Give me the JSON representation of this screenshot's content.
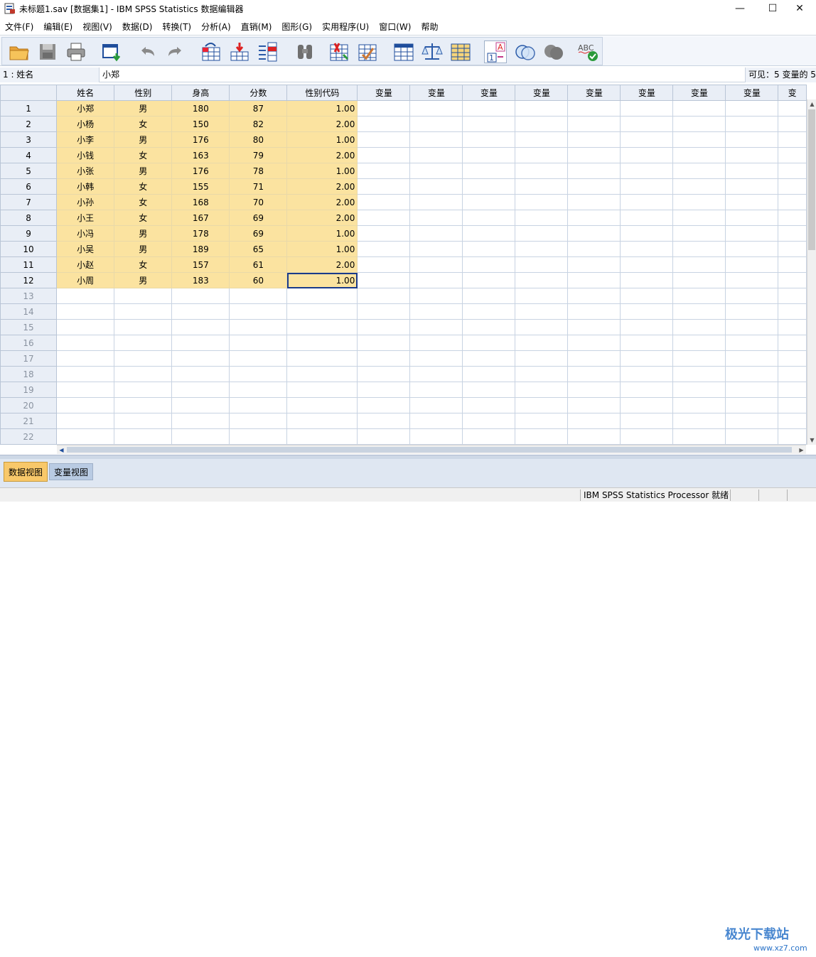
{
  "window": {
    "title": "未标题1.sav [数据集1] - IBM SPSS Statistics 数据编辑器",
    "minimize": "—",
    "maximize": "☐",
    "close": "✕"
  },
  "menu": [
    "文件(F)",
    "编辑(E)",
    "视图(V)",
    "数据(D)",
    "转换(T)",
    "分析(A)",
    "直销(M)",
    "图形(G)",
    "实用程序(U)",
    "窗口(W)",
    "帮助"
  ],
  "toolbar": {
    "icons": [
      "open-folder-icon",
      "save-icon",
      "print-icon",
      "dialog-recall-icon",
      "undo-icon",
      "redo-icon",
      "goto-case-icon",
      "goto-variable-icon",
      "variables-icon",
      "find-icon",
      "insert-cases-icon",
      "insert-variable-icon",
      "split-file-icon",
      "weight-cases-icon",
      "select-cases-icon",
      "value-labels-icon",
      "use-sets-icon",
      "show-all-variables-icon",
      "spell-check-icon"
    ]
  },
  "cell_editor": {
    "ref": "1 : 姓名",
    "value": "小郑",
    "visible": "可见：5 变量的 5"
  },
  "grid": {
    "columns": [
      "姓名",
      "性别",
      "身高",
      "分数",
      "性别代码",
      "变量",
      "变量",
      "变量",
      "变量",
      "变量",
      "变量",
      "变量",
      "变量",
      "变"
    ],
    "rows": [
      [
        "小郑",
        "男",
        "180",
        "87",
        "1.00"
      ],
      [
        "小杨",
        "女",
        "150",
        "82",
        "2.00"
      ],
      [
        "小李",
        "男",
        "176",
        "80",
        "1.00"
      ],
      [
        "小钱",
        "女",
        "163",
        "79",
        "2.00"
      ],
      [
        "小张",
        "男",
        "176",
        "78",
        "1.00"
      ],
      [
        "小韩",
        "女",
        "155",
        "71",
        "2.00"
      ],
      [
        "小孙",
        "女",
        "168",
        "70",
        "2.00"
      ],
      [
        "小王",
        "女",
        "167",
        "69",
        "2.00"
      ],
      [
        "小冯",
        "男",
        "178",
        "69",
        "1.00"
      ],
      [
        "小吴",
        "男",
        "189",
        "65",
        "1.00"
      ],
      [
        "小赵",
        "女",
        "157",
        "61",
        "2.00"
      ],
      [
        "小周",
        "男",
        "183",
        "60",
        "1.00"
      ]
    ],
    "empty_row_numbers": [
      "13",
      "14",
      "15",
      "16",
      "17",
      "18",
      "19",
      "20",
      "21",
      "22"
    ],
    "selected_cell": {
      "row": 12,
      "column": "性别代码"
    }
  },
  "tabs": {
    "data_view": "数据视图",
    "variable_view": "变量视图"
  },
  "status": {
    "processor": "IBM SPSS Statistics Processor 就绪"
  },
  "watermark": {
    "brand": "极光下载站",
    "url": "www.xz7.com"
  },
  "colors": {
    "data_cell": "#fbe3a0",
    "active_tab": "#f8c86a",
    "header": "#e9eef6"
  }
}
